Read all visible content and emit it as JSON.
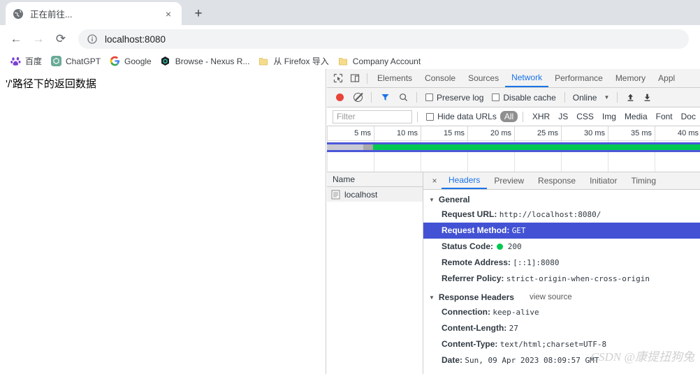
{
  "browser": {
    "tab": {
      "title": "正在前往...",
      "favicon": "globe-icon",
      "close": "×"
    },
    "new_tab": "+",
    "nav": {
      "back": "←",
      "forward": "→",
      "reload": "⟳"
    },
    "omnibox": {
      "value": "localhost:8080",
      "info_icon": "info-circle-icon"
    },
    "bookmarks": [
      {
        "label": "百度",
        "icon": "baidu-icon"
      },
      {
        "label": "ChatGPT",
        "icon": "chatgpt-icon"
      },
      {
        "label": "Google",
        "icon": "google-icon"
      },
      {
        "label": "Browse - Nexus R...",
        "icon": "nexus-icon"
      },
      {
        "label": "从 Firefox 导入",
        "icon": "folder-icon"
      },
      {
        "label": "Company Account",
        "icon": "folder-icon"
      }
    ]
  },
  "page": {
    "content": "'/'路径下的返回数据"
  },
  "devtools": {
    "panel_tabs": [
      {
        "label": "Elements",
        "active": false
      },
      {
        "label": "Console",
        "active": false
      },
      {
        "label": "Sources",
        "active": false
      },
      {
        "label": "Network",
        "active": true
      },
      {
        "label": "Performance",
        "active": false
      },
      {
        "label": "Memory",
        "active": false
      },
      {
        "label": "Appl",
        "active": false
      }
    ],
    "inspect_icon": "inspect-cursor-icon",
    "device_icon": "device-toolbar-icon",
    "toolbar": {
      "record_icon": "record-dot-icon",
      "clear_icon": "clear-no-entry-icon",
      "filter_icon": "funnel-icon",
      "search_icon": "search-icon",
      "preserve_log": "Preserve log",
      "disable_cache": "Disable cache",
      "throttle": "Online",
      "throttle_caret": "▼",
      "import_icon": "upload-arrow-icon",
      "export_icon": "download-arrow-icon"
    },
    "filterbar": {
      "placeholder": "Filter",
      "hide_data_urls": "Hide data URLs",
      "types": [
        "All",
        "XHR",
        "JS",
        "CSS",
        "Img",
        "Media",
        "Font",
        "Doc"
      ],
      "active_type": "All"
    },
    "timeline": {
      "ticks": [
        "5 ms",
        "10 ms",
        "15 ms",
        "20 ms",
        "25 ms",
        "30 ms",
        "35 ms",
        "40 ms"
      ],
      "colors": {
        "waiting": "#c9c9d4",
        "download": "#00c853",
        "marker": "#4b57d8"
      }
    },
    "requests": {
      "header": "Name",
      "rows": [
        {
          "name": "localhost",
          "icon": "document-icon",
          "selected": true
        }
      ]
    },
    "detail": {
      "close": "×",
      "tabs": [
        {
          "label": "Headers",
          "active": true
        },
        {
          "label": "Preview",
          "active": false
        },
        {
          "label": "Response",
          "active": false
        },
        {
          "label": "Initiator",
          "active": false
        },
        {
          "label": "Timing",
          "active": false
        }
      ],
      "general": {
        "title": "General",
        "rows": [
          {
            "key": "Request URL:",
            "value": "http://localhost:8080/",
            "selected": false
          },
          {
            "key": "Request Method:",
            "value": "GET",
            "selected": true
          },
          {
            "key": "Status Code:",
            "value": "200",
            "selected": false,
            "status_dot": "#00c853"
          },
          {
            "key": "Remote Address:",
            "value": "[::1]:8080",
            "selected": false
          },
          {
            "key": "Referrer Policy:",
            "value": "strict-origin-when-cross-origin",
            "selected": false
          }
        ]
      },
      "response_headers": {
        "title": "Response Headers",
        "view_source": "view source",
        "rows": [
          {
            "key": "Connection:",
            "value": "keep-alive"
          },
          {
            "key": "Content-Length:",
            "value": "27"
          },
          {
            "key": "Content-Type:",
            "value": "text/html;charset=UTF-8"
          },
          {
            "key": "Date:",
            "value": "Sun, 09 Apr 2023 08:09:57 GMT"
          }
        ]
      }
    }
  },
  "watermark": "CSDN @康提扭狗兔"
}
